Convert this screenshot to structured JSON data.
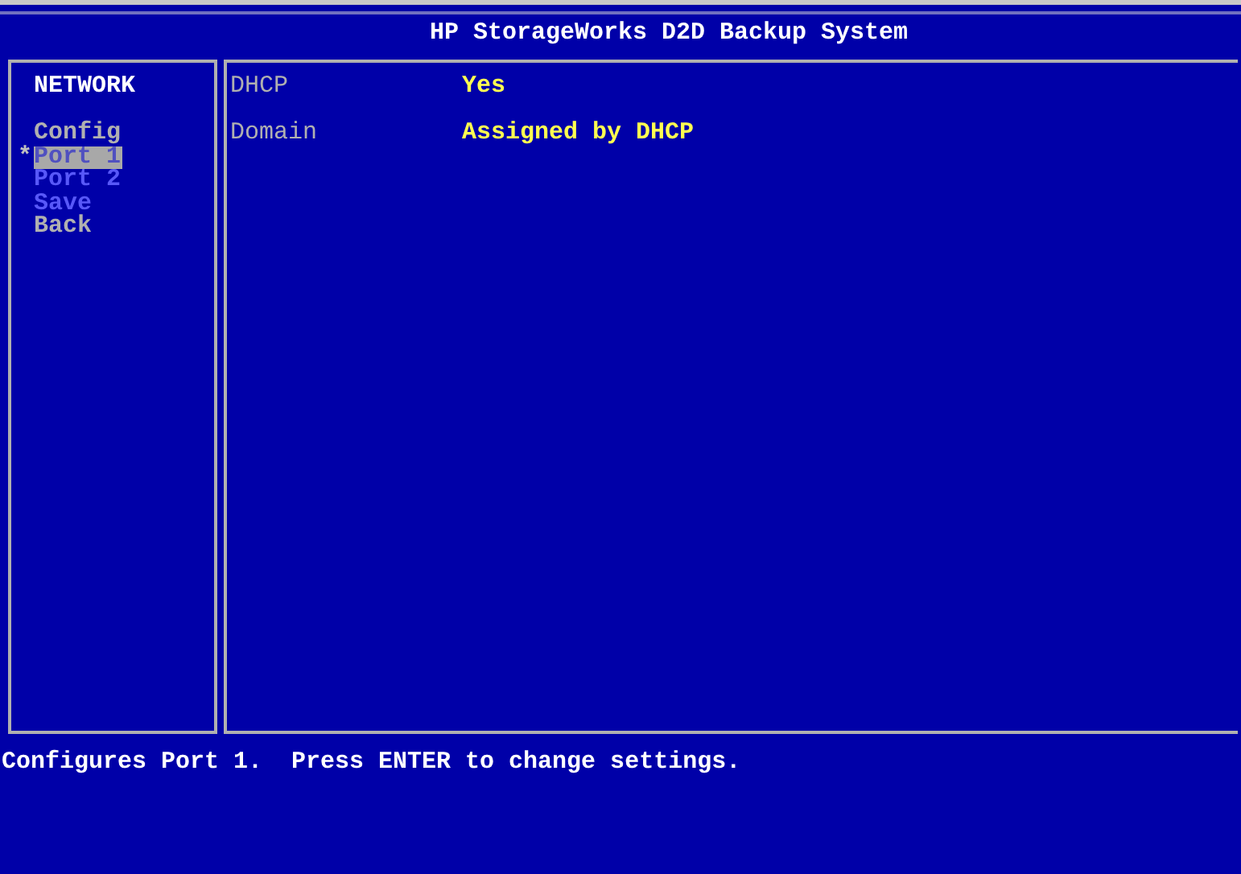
{
  "window": {
    "title": "HP StorageWorks D2D Backup System"
  },
  "menu": {
    "heading": "NETWORK",
    "cursor": "*",
    "items": [
      {
        "label": "Config",
        "selected": false,
        "disabled": false
      },
      {
        "label": "Port 1",
        "selected": true,
        "disabled": false
      },
      {
        "label": "Port 2",
        "selected": false,
        "disabled": true
      },
      {
        "label": "Save",
        "selected": false,
        "disabled": true
      },
      {
        "label": "Back",
        "selected": false,
        "disabled": false
      }
    ]
  },
  "fields": [
    {
      "label": "DHCP",
      "value": "Yes"
    },
    {
      "label": "Domain",
      "value": "Assigned by DHCP"
    }
  ],
  "status_bar": "Configures Port 1.  Press ENTER to change settings."
}
